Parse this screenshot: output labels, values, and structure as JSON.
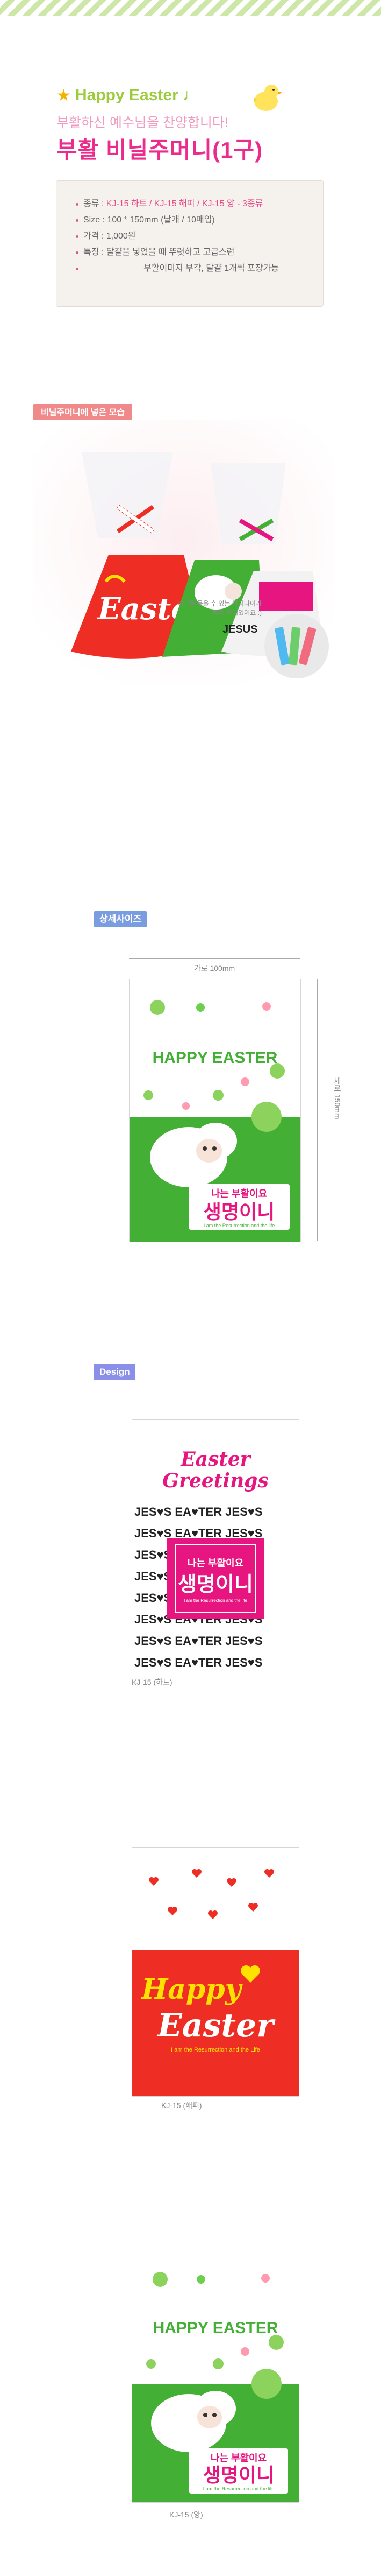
{
  "header": {
    "star_glyph": "★",
    "line1": "Happy Easter ♩",
    "line2": "부활하신 예수님을 찬양합니다!",
    "line3": "부활 비닐주머니(1구)"
  },
  "specs": {
    "items": [
      {
        "label": "종류 : ",
        "value": "KJ-15 하트 / KJ-15 해피 / KJ-15 양 - 3종류"
      },
      {
        "label": "Size : ",
        "value": "100 * 150mm (낱개 / 10매입)"
      },
      {
        "label": "가격 : ",
        "value": "1,000원"
      },
      {
        "label": "특징 : ",
        "value": "달걀을 넣었을 때 뚜렷하고 고급스런"
      }
    ],
    "extra_line": "부활이미지 부각, 달걀 1개씩 포장가능"
  },
  "photo": {
    "badge": "비닐주머니에 넣은 모습",
    "bag_text_easter": "Easter",
    "bag_text_jesus": "JESUS",
    "tie_note_line1": "비닐을 묶을 수 있는 컬러타이가",
    "tie_note_line2": "함께 들어있어요 :)"
  },
  "size_section": {
    "title": "상세사이즈",
    "width_label": "가로 100mm",
    "height_label": "세로 150mm",
    "happy_easter": "HAPPY EASTER",
    "slogan_small": "나는 부활이요",
    "slogan_big": "생명이니",
    "slogan_eng": "I am the Resurrection and the life"
  },
  "design_section": {
    "title": "Design",
    "designs": [
      {
        "id": "heart",
        "title_line1": "Easter",
        "title_line2": "Greetings",
        "pattern_row": "JES♥S EA♥TER JES♥S",
        "slogan_small": "나는 부활이요",
        "slogan_big": "생명이니",
        "slogan_eng": "I am the Resurrection and the life",
        "caption": "KJ-15 (하트)"
      },
      {
        "id": "happy",
        "happy": "Happy",
        "easter": "Easter",
        "sub": "I am the Resurrection and the Life",
        "caption": "KJ-15 (해피)"
      },
      {
        "id": "sheep",
        "happy_easter": "HAPPY EASTER",
        "slogan_small": "나는 부활이요",
        "slogan_big": "생명이니",
        "slogan_eng": "I am the Resurrection and the life",
        "caption": "KJ-15 (양)"
      }
    ]
  },
  "colors": {
    "green": "#43b035",
    "pink": "#e7157f",
    "red": "#ee2d24",
    "yellow": "#ffe100"
  }
}
